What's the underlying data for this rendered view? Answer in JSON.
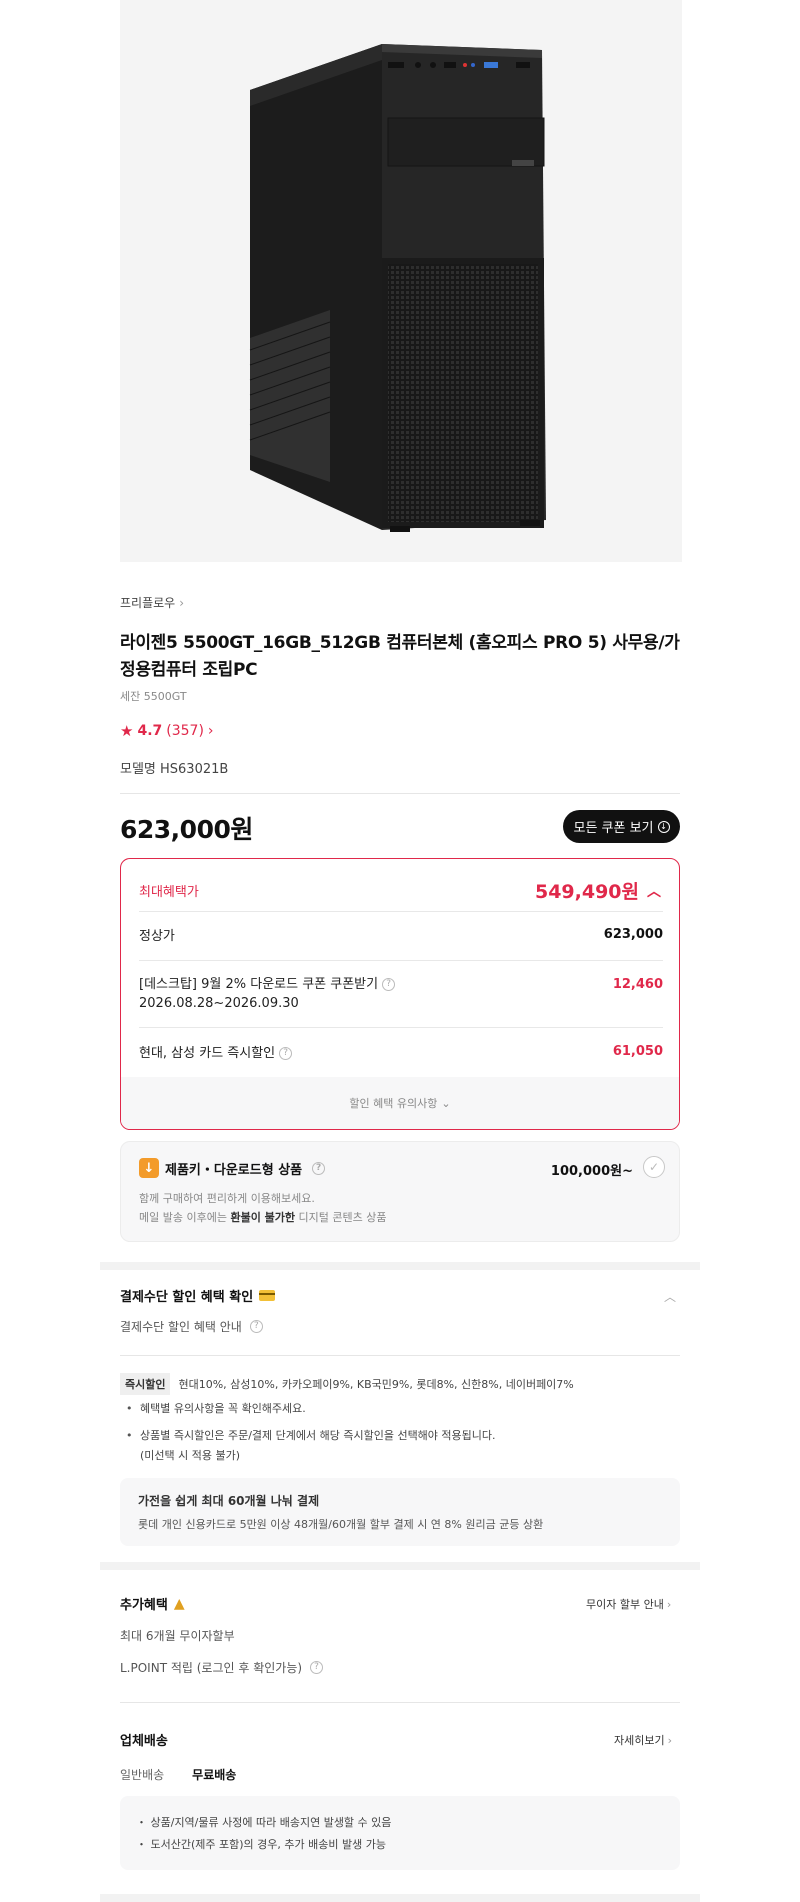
{
  "product": {
    "brand": "프리플로우",
    "title": "라이젠5 5500GT_16GB_512GB 컴퓨터본체 (홈오피스 PRO 5) 사무용/가정용컴퓨터 조립PC",
    "subtitle": "세잔 5500GT",
    "rating": "4.7",
    "review_count": "(357)",
    "model": "모델명 HS63021B",
    "price": "623,000원",
    "image_icon": "pc-tower-image"
  },
  "coupon_button": {
    "label": "모든 쿠폰 보기"
  },
  "benefit": {
    "max_label": "최대혜택가",
    "max_value": "549,490원",
    "rows": [
      {
        "label": "정상가",
        "value": "623,000"
      },
      {
        "label": "[데스크탑] 9월 2% 다운로드 쿠폰 쿠폰받기",
        "sub": "2026.08.28~2026.09.30",
        "value": "12,460"
      },
      {
        "label": "현대, 삼성 카드 즉시할인",
        "value": "61,050"
      }
    ],
    "footer": "할인 혜택 유의사항"
  },
  "download": {
    "title": "제품키・다운로드형 상품",
    "price": "100,000원~",
    "line1": "함께 구매하여 편리하게 이용해보세요.",
    "line2_prefix": "메일 발송 이후에는 ",
    "line2_bold": "환불이 불가한",
    "line2_suffix": " 디지털 콘텐츠 상품"
  },
  "payment": {
    "title": "결제수단 할인 혜택 확인",
    "guide": "결제수단 할인 혜택 안내",
    "instant_tag": "즉시할인",
    "instant_text": "현대10%, 삼성10%, 카카오페이9%, KB국민9%, 롯데8%, 신한8%, 네이버페이7%",
    "bullet1": "혜택별 유의사항을 꼭 확인해주세요.",
    "bullet2_line1": "상품별 즉시할인은 주문/결제 단계에서 해당 즉시할인을 선택해야 적용됩니다.",
    "bullet2_line2": "(미선택 시 적용 불가)",
    "install_title": "가전을 쉽게 최대 60개월 나눠 결제",
    "install_desc": "롯데 개인 신용카드로 5만원 이상 48개월/60개월 할부 결제 시 연 8% 원리금 균등 상환"
  },
  "extra": {
    "title": "추가혜택",
    "link": "무이자 할부 안내",
    "line1": "최대 6개월 무이자할부",
    "line2": "L.POINT 적립 (로그인 후 확인가능)"
  },
  "shipping": {
    "title": "업체배송",
    "link": "자세히보기",
    "type_label": "일반배송",
    "type_value": "무료배송",
    "note1": "・ 상품/지역/물류 사정에 따라 배송지연 발생할 수 있음",
    "note2": "・ 도서산간(제주 포함)의 경우, 추가 배송비 발생 가능"
  },
  "colors": {
    "accent": "#e0284a",
    "dark": "#111111",
    "download_badge": "#f39b2a"
  }
}
